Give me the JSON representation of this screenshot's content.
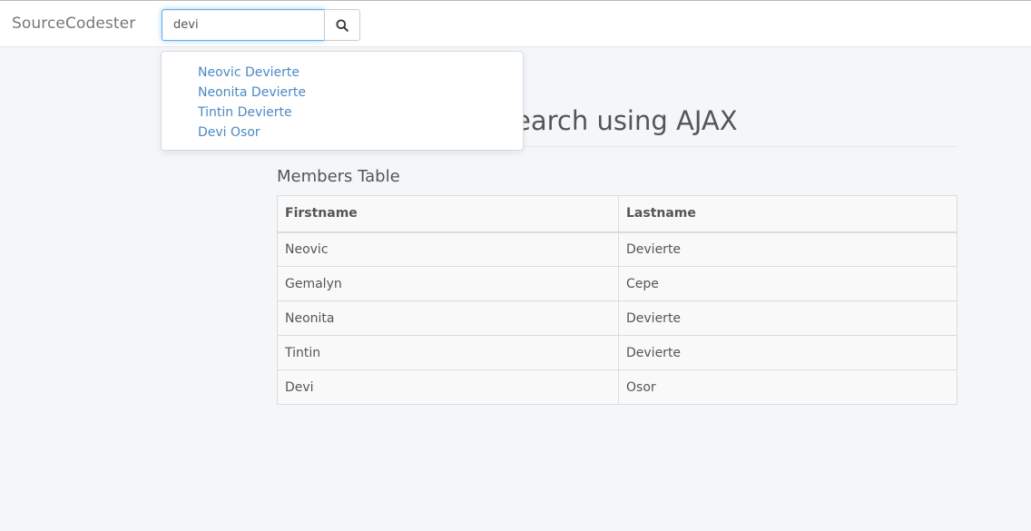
{
  "navbar": {
    "brand": "SourceCodester",
    "search": {
      "value": "devi",
      "placeholder": ""
    },
    "search_button_icon": "search-icon"
  },
  "suggestions": [
    {
      "label": "Neovic Devierte"
    },
    {
      "label": "Neonita Devierte"
    },
    {
      "label": "Tintin Devierte"
    },
    {
      "label": "Devi Osor"
    }
  ],
  "main": {
    "title": "earch using AJAX",
    "table_title": "Members Table",
    "columns": [
      "Firstname",
      "Lastname"
    ],
    "rows": [
      [
        "Neovic",
        "Devierte"
      ],
      [
        "Gemalyn",
        "Cepe"
      ],
      [
        "Neonita",
        "Devierte"
      ],
      [
        "Tintin",
        "Devierte"
      ],
      [
        "Devi",
        "Osor"
      ]
    ]
  },
  "colors": {
    "link": "#4a8ac4",
    "focus_border": "#66afe9",
    "background": "#f4f7fa"
  }
}
